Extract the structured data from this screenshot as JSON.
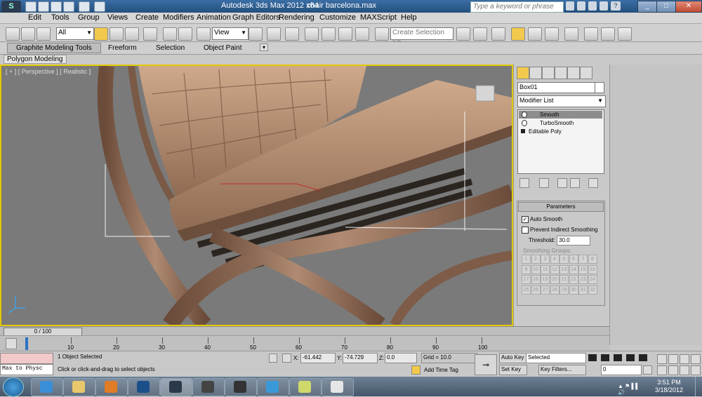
{
  "window": {
    "title": "Autodesk 3ds Max  2012 x64",
    "file": "chair barcelona.max",
    "search_placeholder": "Type a keyword or phrase"
  },
  "menu": [
    "Edit",
    "Tools",
    "Group",
    "Views",
    "Create",
    "Modifiers",
    "Animation",
    "Graph Editors",
    "Rendering",
    "Customize",
    "MAXScript",
    "Help"
  ],
  "toolbar": {
    "filter_value": "All",
    "ref_coord": "View",
    "selection_set_placeholder": "Create Selection Se"
  },
  "ribbon": {
    "tabs": [
      "Graphite Modeling Tools",
      "Freeform",
      "Selection",
      "Object Paint"
    ],
    "panel": "Polygon Modeling"
  },
  "viewport": {
    "label": "[ + ] [ Perspective ] [ Realistic ]"
  },
  "command_panel": {
    "object_name": "Box01",
    "modifier_list": "Modifier List",
    "stack": [
      "Smooth",
      "TurboSmooth",
      "Editable Poly"
    ],
    "rollout_title": "Parameters",
    "auto_smooth": "Auto Smooth",
    "prevent_indirect": "Prevent Indirect Smoothing",
    "threshold_label": "Threshold:",
    "threshold_value": "30.0",
    "smoothing_groups_label": "Smoothing Groups:",
    "smoothing_groups": [
      "1",
      "2",
      "3",
      "4",
      "5",
      "6",
      "7",
      "8",
      "9",
      "10",
      "11",
      "12",
      "13",
      "14",
      "15",
      "16",
      "17",
      "18",
      "19",
      "20",
      "21",
      "22",
      "23",
      "24",
      "25",
      "26",
      "27",
      "28",
      "29",
      "30",
      "31",
      "32"
    ]
  },
  "timeline": {
    "frame_display": "0 / 100",
    "ticks": [
      "0",
      "10",
      "20",
      "30",
      "40",
      "50",
      "60",
      "70",
      "80",
      "90",
      "100"
    ]
  },
  "status": {
    "maxscript": "Max to Physc",
    "selected": "1 Object Selected",
    "prompt": "Click or click-and-drag to select objects",
    "x_label": "X:",
    "x_value": "-61.442",
    "y_label": "Y:",
    "y_value": "-74.729",
    "z_label": "Z:",
    "z_value": "0.0",
    "grid": "Grid = 10.0",
    "add_time_tag": "Add Time Tag",
    "auto_key": "Auto Key",
    "set_key": "Set Key",
    "key_mode": "Selected",
    "key_filters": "Key Filters...",
    "frame_field": "0"
  },
  "taskbar": {
    "time": "3:51 PM",
    "date": "3/18/2012"
  },
  "colors": {
    "viewport_border": "#e3c800",
    "leather": "#b48a6c",
    "title_bar": "#2d5a8a"
  }
}
